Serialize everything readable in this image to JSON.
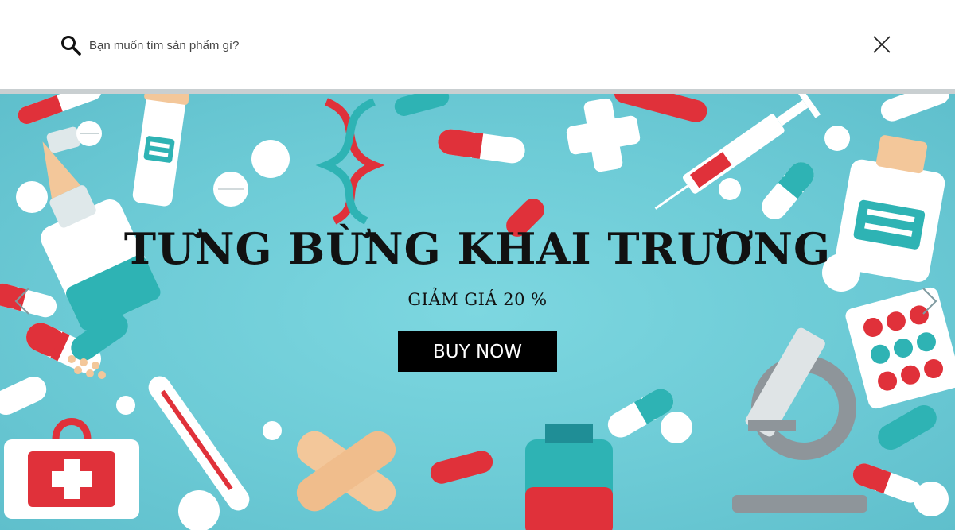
{
  "search": {
    "placeholder": "Bạn muốn tìm sản phẩm gì?",
    "value": "",
    "icon": "search-icon",
    "close_icon": "close-icon"
  },
  "banner": {
    "headline": "TƯNG BỪNG KHAI TRƯƠNG",
    "subline": "GIẢM GIÁ 20 %",
    "cta_label": "BUY NOW",
    "prev_icon": "chevron-left-icon",
    "next_icon": "chevron-right-icon",
    "background_color": "#6dcbd6",
    "accent_colors": [
      "#e0313a",
      "#2eb3b4",
      "#f3c79a",
      "#ffffff"
    ]
  }
}
